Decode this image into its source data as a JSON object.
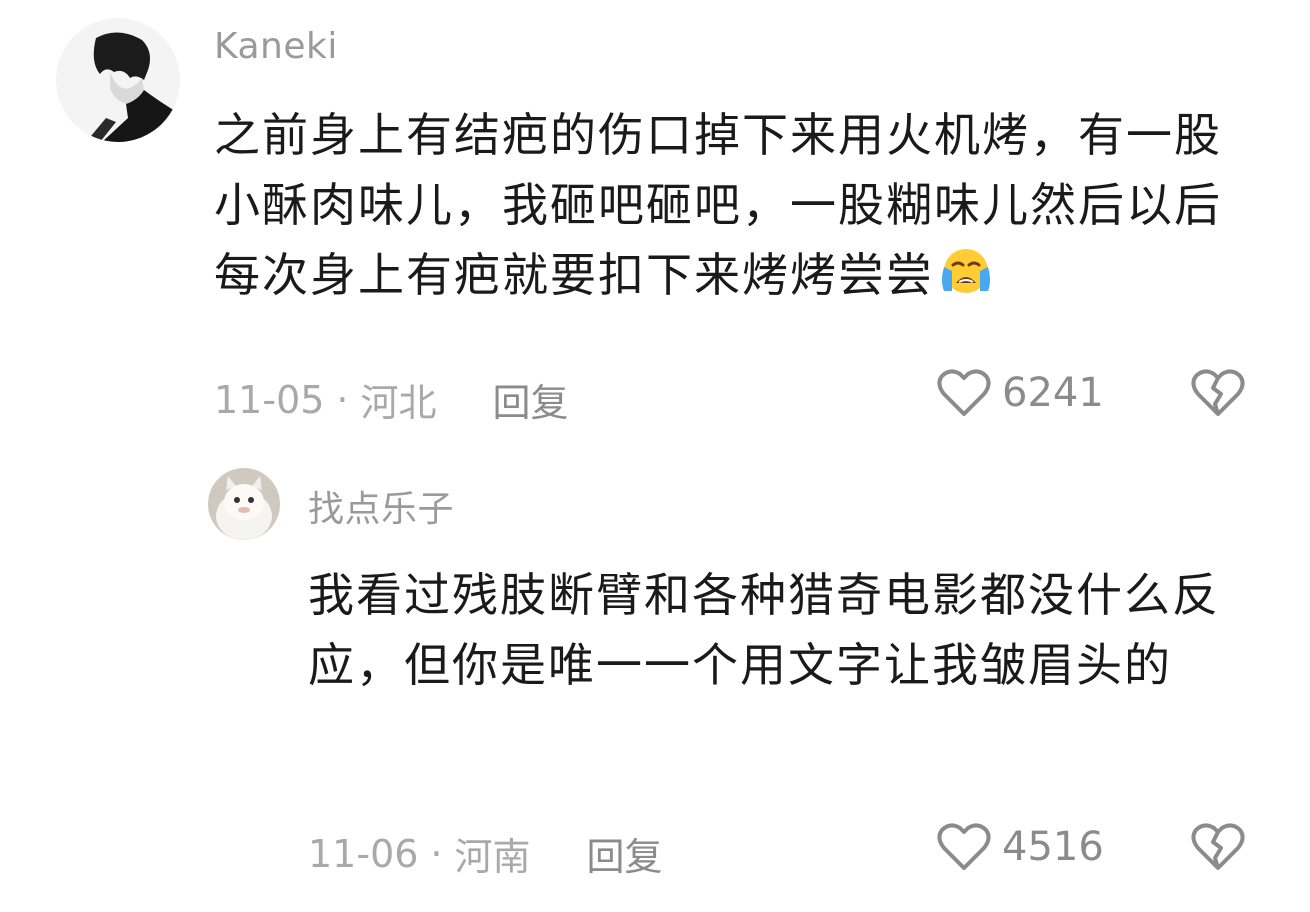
{
  "comments": [
    {
      "username": "Kaneki",
      "content": "之前身上有结疤的伤口掉下来用火机烤，有一股小酥肉味儿，我砸吧砸吧，一股糊味儿然后以后每次身上有疤就要扣下来烤烤尝尝",
      "emoji": "loudly-crying-face",
      "date": "11-05",
      "location": "河北",
      "reply_label": "回复",
      "like_count": "6241"
    },
    {
      "username": "找点乐子",
      "content": "我看过残肢断臂和各种猎奇电影都没什么反应，但你是唯一一个用文字让我皱眉头的",
      "date": "11-06",
      "location": "河南",
      "reply_label": "回复",
      "like_count": "4516"
    }
  ],
  "separator": "·",
  "icons": {
    "like": "heart-outline-icon",
    "dislike": "broken-heart-icon"
  },
  "colors": {
    "text": "#1a1a1a",
    "muted": "#9a9a9a",
    "icon": "#8b8b8b"
  }
}
